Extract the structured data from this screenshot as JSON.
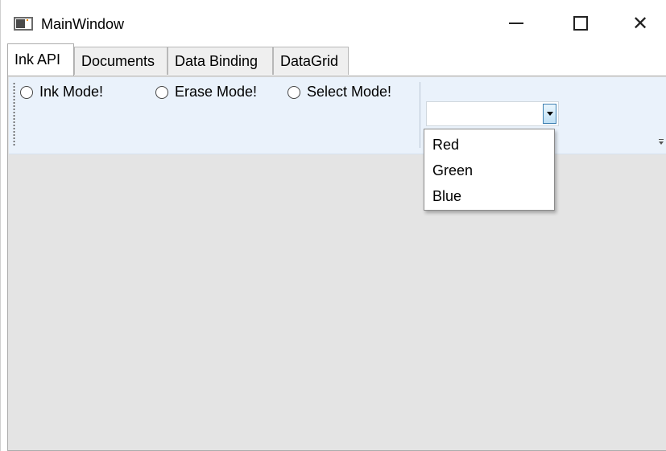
{
  "window": {
    "title": "MainWindow",
    "icons": {
      "app": "app-window-icon",
      "minimize": "minimize-icon",
      "maximize": "maximize-icon",
      "close": "close-icon"
    },
    "close_glyph": "✕"
  },
  "tabs": [
    {
      "label": "Ink API",
      "selected": true
    },
    {
      "label": "Documents",
      "selected": false
    },
    {
      "label": "Data Binding",
      "selected": false
    },
    {
      "label": "DataGrid",
      "selected": false
    }
  ],
  "toolbar": {
    "radios": [
      {
        "label": "Ink Mode!",
        "checked": false
      },
      {
        "label": "Erase Mode!",
        "checked": false
      },
      {
        "label": "Select Mode!",
        "checked": false
      }
    ],
    "combo": {
      "value": "",
      "expanded": true,
      "options": [
        "Red",
        "Green",
        "Blue"
      ]
    }
  },
  "colors": {
    "toolbar_background": "#eaf2fb",
    "content_background": "#e4e4e4",
    "combo_button_border": "#3c7fb1"
  }
}
